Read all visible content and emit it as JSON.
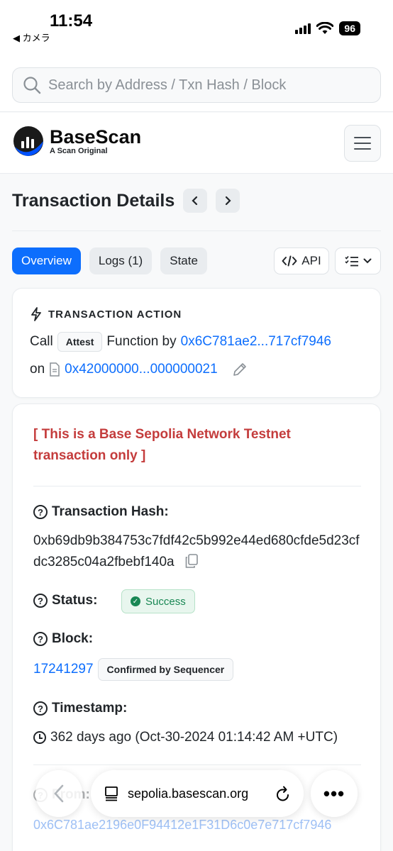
{
  "status_bar": {
    "time": "11:54",
    "back_label": "◀ カメラ",
    "battery": "96"
  },
  "search": {
    "placeholder": "Search by Address / Txn Hash / Block"
  },
  "header": {
    "brand": "BaseScan",
    "tagline": "A Scan Original"
  },
  "page": {
    "title": "Transaction Details"
  },
  "tabs": [
    {
      "label": "Overview",
      "active": true
    },
    {
      "label": "Logs (1)",
      "active": false
    },
    {
      "label": "State",
      "active": false
    }
  ],
  "toolbar": {
    "api_label": "API"
  },
  "action": {
    "heading": "TRANSACTION ACTION",
    "call": "Call",
    "function": "Attest",
    "function_by": "Function by",
    "from": "0x6C781ae2...717cf7946",
    "on": "on",
    "contract": "0x42000000...000000021"
  },
  "details": {
    "testnet_notice": "[ This is a Base Sepolia Network Testnet transaction only ]",
    "hash_label": "Transaction Hash:",
    "hash": "0xb69db9b384753c7fdf42c5b992e44ed680cfde5d23cfdc3285c04a2fbebf140a",
    "status_label": "Status:",
    "status": "Success",
    "block_label": "Block:",
    "block": "17241297",
    "block_note": "Confirmed by Sequencer",
    "timestamp_label": "Timestamp:",
    "timestamp": "362 days ago (Oct-30-2024 01:14:42 AM +UTC)",
    "from_label_partial": "From:",
    "from_full": "0x6C781ae2196e0F94412e1F31D6c0e7e717cf7946"
  },
  "browser": {
    "url": "sepolia.basescan.org"
  },
  "colors": {
    "accent": "#0d6efd",
    "success": "#198754",
    "testnet_red": "#c43c3c"
  }
}
